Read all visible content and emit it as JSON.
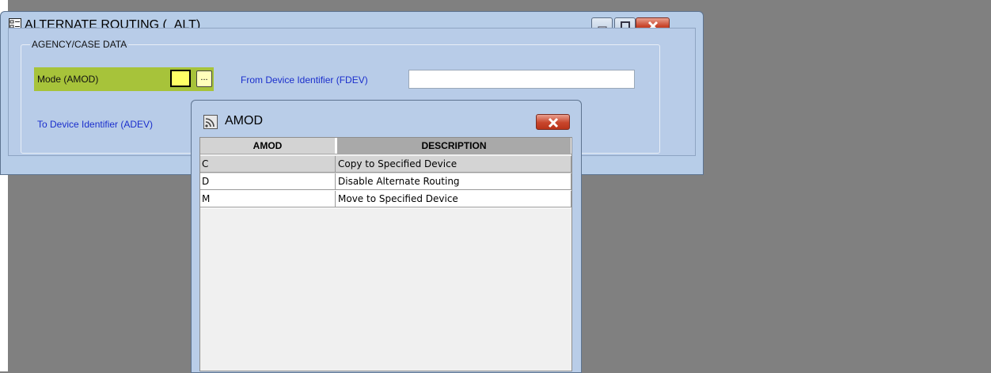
{
  "main_window": {
    "title": "ALTERNATE ROUTING (_ALT)",
    "group_title": "AGENCY/CASE DATA",
    "fields": {
      "mode_label": "Mode (AMOD)",
      "mode_value": "",
      "lookup_button_label": "...",
      "fdev_label": "From Device Identifier (FDEV)",
      "fdev_value": "",
      "adev_label": "To Device Identifier (ADEV)"
    }
  },
  "lookup_popup": {
    "title": "AMOD",
    "columns": [
      "AMOD",
      "DESCRIPTION"
    ],
    "rows": [
      {
        "code": "C",
        "description": "Copy to Specified Device"
      },
      {
        "code": "D",
        "description": "Disable Alternate Routing"
      },
      {
        "code": "M",
        "description": "Move to Specified Device"
      }
    ],
    "selected_row": 0
  },
  "colors": {
    "desktop": "#808080",
    "window_bg": "#b8cce8",
    "mode_highlight": "#a7c33a",
    "mode_input": "#ffff66",
    "blue_label": "#1a2ecc",
    "selected_row": "#d4d4d4"
  },
  "icons": {
    "app": "form-icon",
    "popup": "feed-icon",
    "minimize": "minimize-icon",
    "maximize": "maximize-icon",
    "close": "close-icon"
  }
}
